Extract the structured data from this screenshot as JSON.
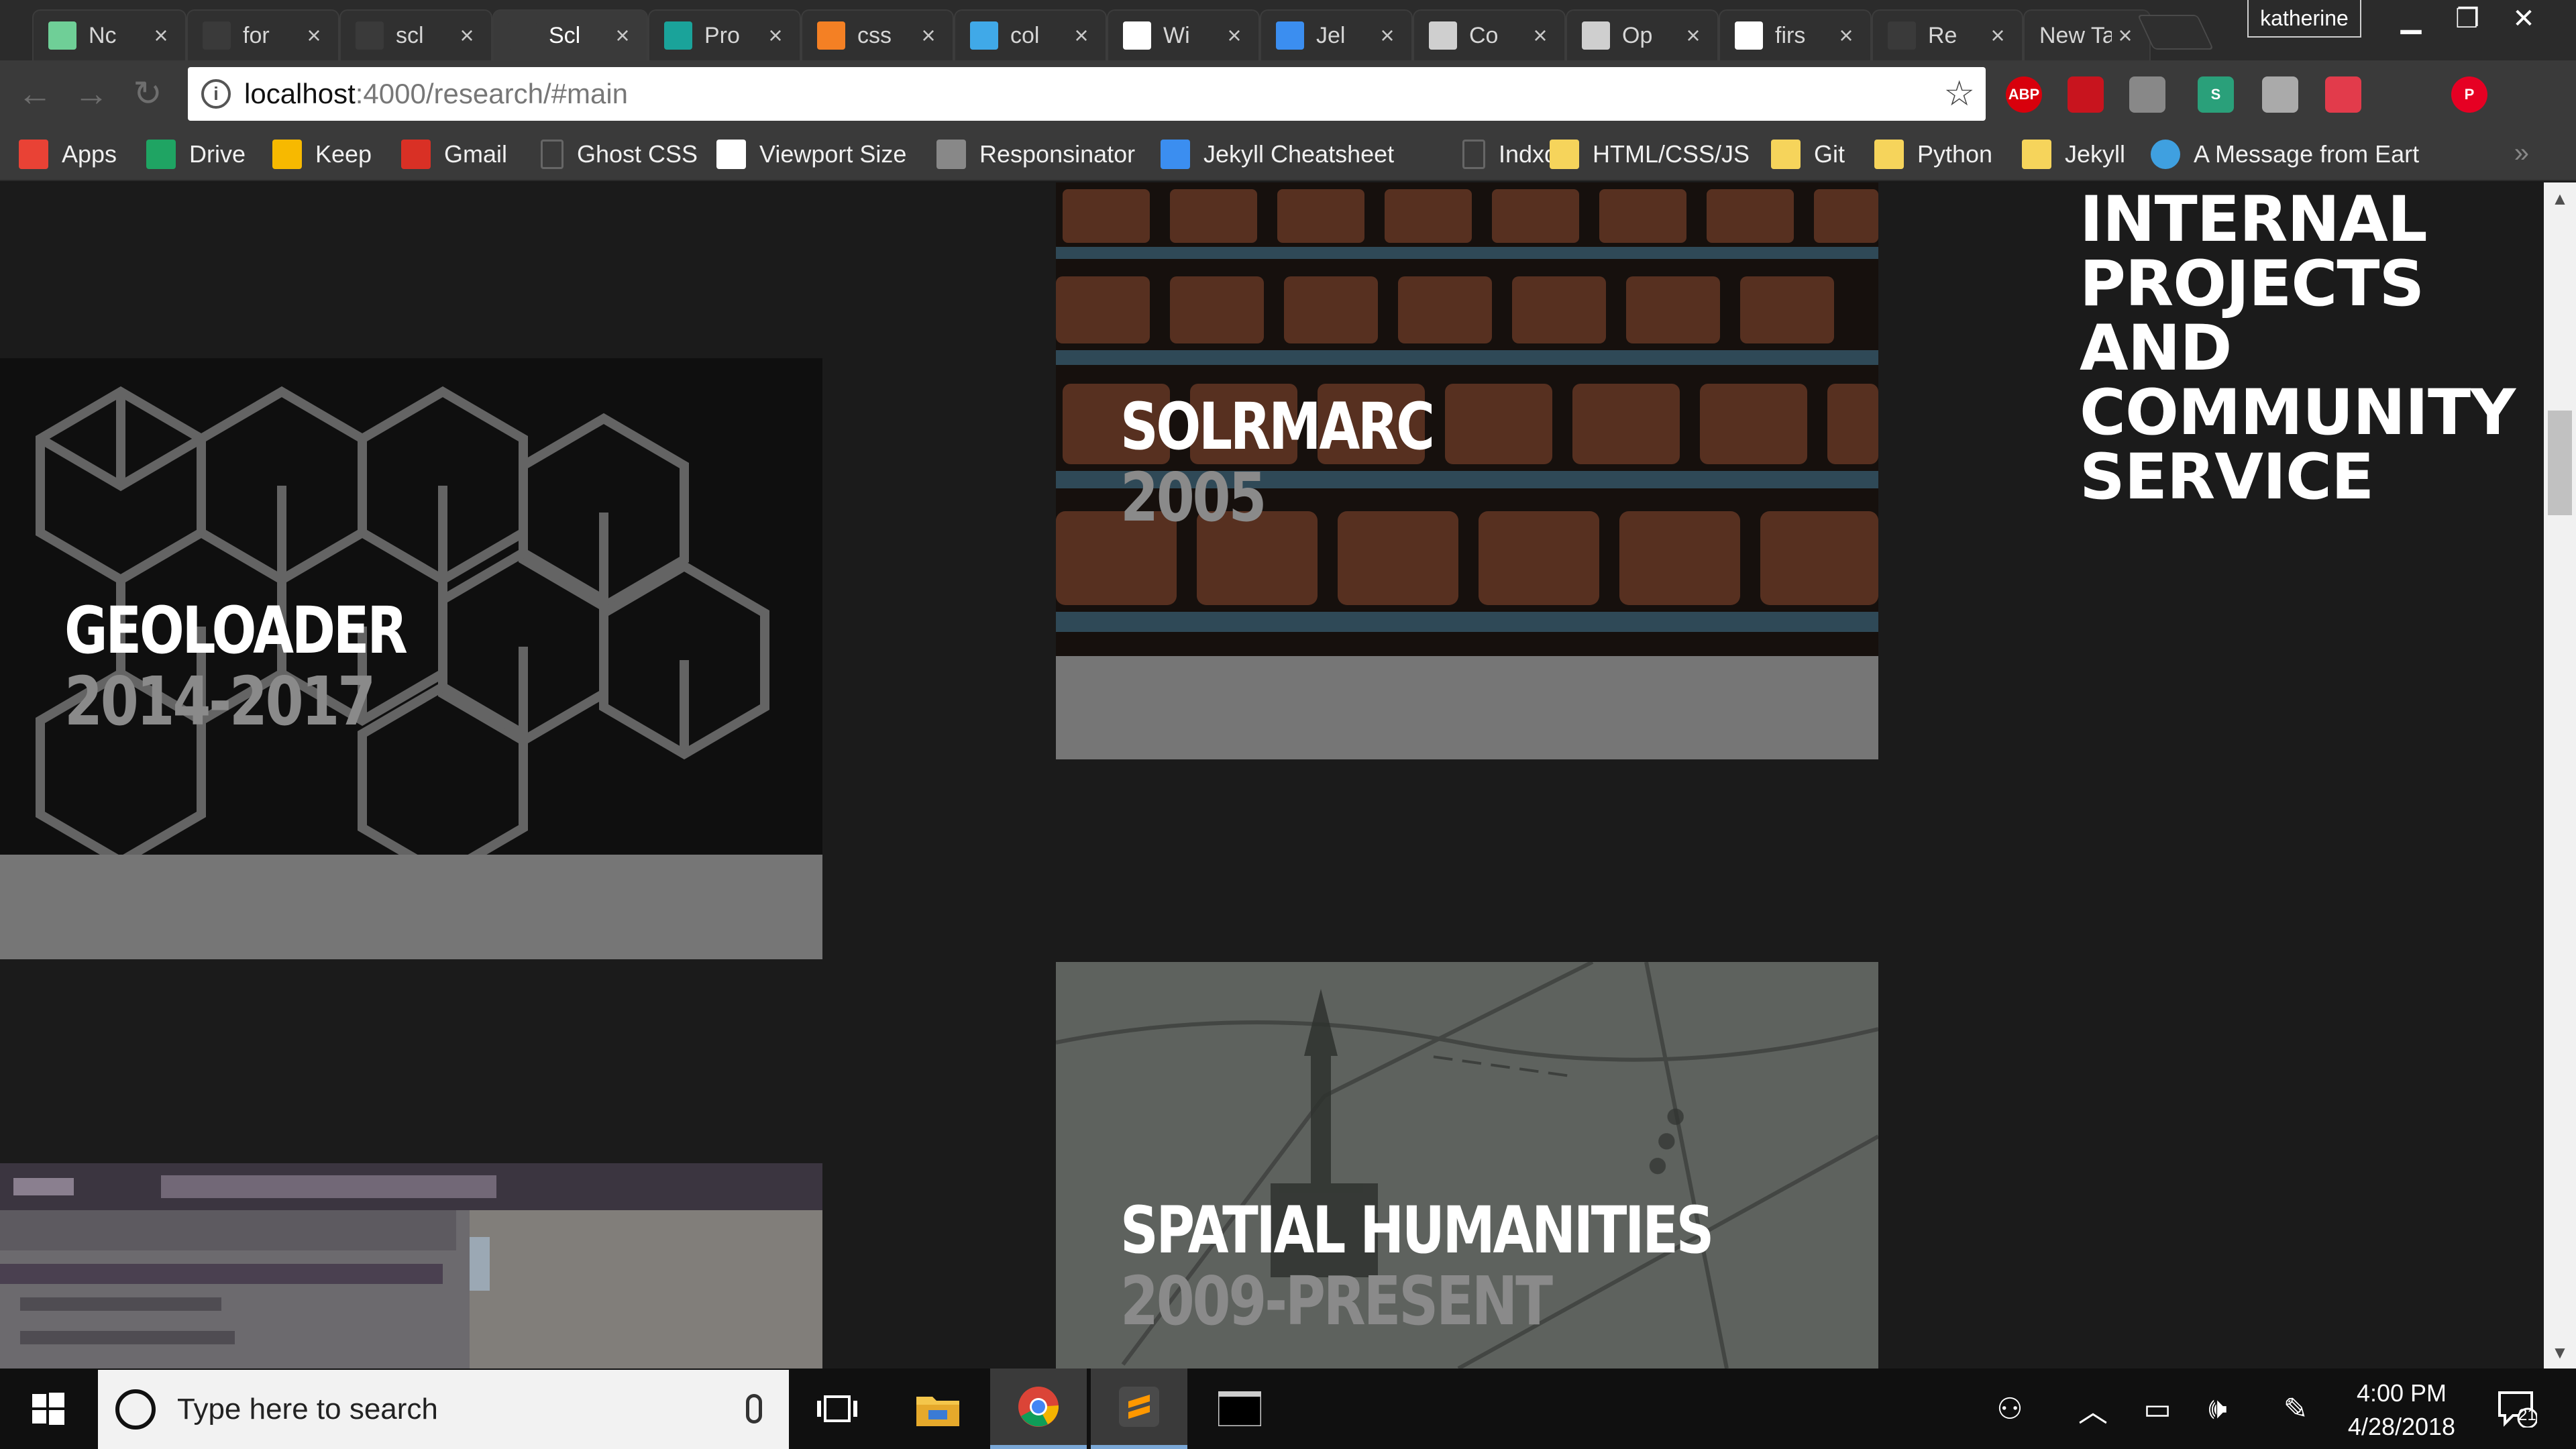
{
  "browser": {
    "tabs": [
      {
        "label": "Nc",
        "favicon": "notion-icon",
        "color": "#6fcf97"
      },
      {
        "label": "for",
        "favicon": "page-icon",
        "color": "#3a3a3a"
      },
      {
        "label": "scl",
        "favicon": "github-icon",
        "color": "#3a3a3a"
      },
      {
        "label": "Scl",
        "favicon": "page-icon",
        "color": "#3a3a3a",
        "active": true
      },
      {
        "label": "Pro",
        "favicon": "teal-square-icon",
        "color": "#1aa39a"
      },
      {
        "label": "css",
        "favicon": "stackoverflow-icon",
        "color": "#f48024"
      },
      {
        "label": "col",
        "favicon": "codepen-icon",
        "color": "#40a9e8"
      },
      {
        "label": "Wi",
        "favicon": "viewport-icon",
        "color": "#ffffff"
      },
      {
        "label": "Jel",
        "favicon": "jekyll-icon",
        "color": "#3b8ef0"
      },
      {
        "label": "Co",
        "favicon": "drop-icon",
        "color": "#cfcfcf"
      },
      {
        "label": "Op",
        "favicon": "drop-icon",
        "color": "#cfcfcf"
      },
      {
        "label": "firs",
        "favicon": "google-icon",
        "color": "#ffffff"
      },
      {
        "label": "Re",
        "favicon": "page-icon",
        "color": "#3a3a3a"
      },
      {
        "label": "New Ta",
        "favicon": "",
        "color": "#3a3a3a"
      }
    ],
    "tab_close_glyph": "×",
    "profile_name": "katherine",
    "url_host": "localhost",
    "url_path": ":4000/research/#main",
    "bookmarks": [
      {
        "label": "Apps",
        "icon": "apps-grid-icon",
        "color": "#e94235"
      },
      {
        "label": "Drive",
        "icon": "drive-icon",
        "color": "#1fa463"
      },
      {
        "label": "Keep",
        "icon": "keep-icon",
        "color": "#f7b900"
      },
      {
        "label": "Gmail",
        "icon": "gmail-icon",
        "color": "#d93025"
      },
      {
        "label": "Ghost CSS",
        "icon": "page-icon",
        "color": "#555555"
      },
      {
        "label": "Viewport Size",
        "icon": "viewport-icon",
        "color": "#ffffff"
      },
      {
        "label": "Responsinator",
        "icon": "responsinator-icon",
        "color": "#888888"
      },
      {
        "label": "Jekyll Cheatsheet",
        "icon": "jekyll-icon",
        "color": "#3b8ef0"
      },
      {
        "label": "Indxd",
        "icon": "page-icon",
        "color": "#555555"
      },
      {
        "label": "HTML/CSS/JS",
        "icon": "folder-icon",
        "color": "#f6d45b"
      },
      {
        "label": "Git",
        "icon": "folder-icon",
        "color": "#f6d45b"
      },
      {
        "label": "Python",
        "icon": "folder-icon",
        "color": "#f6d45b"
      },
      {
        "label": "Jekyll",
        "icon": "folder-icon",
        "color": "#f6d45b"
      },
      {
        "label": "A Message from Eart",
        "icon": "globe-icon",
        "color": "#3fa0e0"
      }
    ],
    "extensions": [
      {
        "name": "adblock-plus-icon",
        "label": "ABP",
        "color": "#d8000c"
      },
      {
        "name": "pdf-icon",
        "label": "",
        "color": "#c8141e"
      },
      {
        "name": "inspect-icon",
        "label": "",
        "color": "#888888"
      },
      {
        "name": "stylus-icon",
        "label": "S",
        "color": "#2aa07a"
      },
      {
        "name": "bulb-icon",
        "label": "",
        "color": "#aaaaaa"
      },
      {
        "name": "pocket-icon",
        "label": "",
        "color": "#e23b4b"
      },
      {
        "name": "blank-extension-icon",
        "label": "",
        "color": "#3a3a3a"
      },
      {
        "name": "pinterest-icon",
        "label": "P",
        "color": "#e60023"
      }
    ]
  },
  "page": {
    "cards": [
      {
        "title": "GEOLOADER",
        "years": "2014-2017",
        "image": "wire-cubes"
      },
      {
        "title": "SOLRMARC",
        "years": "2005",
        "image": "auditorium-seats"
      },
      {
        "title": "",
        "years": "",
        "image": "map-app-screenshot"
      },
      {
        "title": "SPATIAL HUMANITIES",
        "years": "2009-PRESENT",
        "image": "old-map"
      }
    ],
    "side_heading": [
      "INTERNAL",
      "PROJECTS",
      "AND",
      "COMMUNITY",
      "SERVICE"
    ]
  },
  "taskbar": {
    "search_placeholder": "Type here to search",
    "time": "4:00 PM",
    "date": "4/28/2018",
    "notification_count": "21"
  }
}
